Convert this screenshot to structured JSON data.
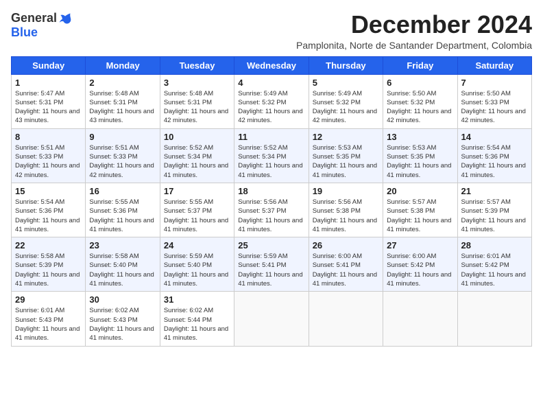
{
  "logo": {
    "general": "General",
    "blue": "Blue"
  },
  "title": "December 2024",
  "location": "Pamplonita, Norte de Santander Department, Colombia",
  "days_of_week": [
    "Sunday",
    "Monday",
    "Tuesday",
    "Wednesday",
    "Thursday",
    "Friday",
    "Saturday"
  ],
  "weeks": [
    [
      {
        "day": "1",
        "sunrise": "5:47 AM",
        "sunset": "5:31 PM",
        "daylight": "11 hours and 43 minutes."
      },
      {
        "day": "2",
        "sunrise": "5:48 AM",
        "sunset": "5:31 PM",
        "daylight": "11 hours and 43 minutes."
      },
      {
        "day": "3",
        "sunrise": "5:48 AM",
        "sunset": "5:31 PM",
        "daylight": "11 hours and 42 minutes."
      },
      {
        "day": "4",
        "sunrise": "5:49 AM",
        "sunset": "5:32 PM",
        "daylight": "11 hours and 42 minutes."
      },
      {
        "day": "5",
        "sunrise": "5:49 AM",
        "sunset": "5:32 PM",
        "daylight": "11 hours and 42 minutes."
      },
      {
        "day": "6",
        "sunrise": "5:50 AM",
        "sunset": "5:32 PM",
        "daylight": "11 hours and 42 minutes."
      },
      {
        "day": "7",
        "sunrise": "5:50 AM",
        "sunset": "5:33 PM",
        "daylight": "11 hours and 42 minutes."
      }
    ],
    [
      {
        "day": "8",
        "sunrise": "5:51 AM",
        "sunset": "5:33 PM",
        "daylight": "11 hours and 42 minutes."
      },
      {
        "day": "9",
        "sunrise": "5:51 AM",
        "sunset": "5:33 PM",
        "daylight": "11 hours and 42 minutes."
      },
      {
        "day": "10",
        "sunrise": "5:52 AM",
        "sunset": "5:34 PM",
        "daylight": "11 hours and 41 minutes."
      },
      {
        "day": "11",
        "sunrise": "5:52 AM",
        "sunset": "5:34 PM",
        "daylight": "11 hours and 41 minutes."
      },
      {
        "day": "12",
        "sunrise": "5:53 AM",
        "sunset": "5:35 PM",
        "daylight": "11 hours and 41 minutes."
      },
      {
        "day": "13",
        "sunrise": "5:53 AM",
        "sunset": "5:35 PM",
        "daylight": "11 hours and 41 minutes."
      },
      {
        "day": "14",
        "sunrise": "5:54 AM",
        "sunset": "5:36 PM",
        "daylight": "11 hours and 41 minutes."
      }
    ],
    [
      {
        "day": "15",
        "sunrise": "5:54 AM",
        "sunset": "5:36 PM",
        "daylight": "11 hours and 41 minutes."
      },
      {
        "day": "16",
        "sunrise": "5:55 AM",
        "sunset": "5:36 PM",
        "daylight": "11 hours and 41 minutes."
      },
      {
        "day": "17",
        "sunrise": "5:55 AM",
        "sunset": "5:37 PM",
        "daylight": "11 hours and 41 minutes."
      },
      {
        "day": "18",
        "sunrise": "5:56 AM",
        "sunset": "5:37 PM",
        "daylight": "11 hours and 41 minutes."
      },
      {
        "day": "19",
        "sunrise": "5:56 AM",
        "sunset": "5:38 PM",
        "daylight": "11 hours and 41 minutes."
      },
      {
        "day": "20",
        "sunrise": "5:57 AM",
        "sunset": "5:38 PM",
        "daylight": "11 hours and 41 minutes."
      },
      {
        "day": "21",
        "sunrise": "5:57 AM",
        "sunset": "5:39 PM",
        "daylight": "11 hours and 41 minutes."
      }
    ],
    [
      {
        "day": "22",
        "sunrise": "5:58 AM",
        "sunset": "5:39 PM",
        "daylight": "11 hours and 41 minutes."
      },
      {
        "day": "23",
        "sunrise": "5:58 AM",
        "sunset": "5:40 PM",
        "daylight": "11 hours and 41 minutes."
      },
      {
        "day": "24",
        "sunrise": "5:59 AM",
        "sunset": "5:40 PM",
        "daylight": "11 hours and 41 minutes."
      },
      {
        "day": "25",
        "sunrise": "5:59 AM",
        "sunset": "5:41 PM",
        "daylight": "11 hours and 41 minutes."
      },
      {
        "day": "26",
        "sunrise": "6:00 AM",
        "sunset": "5:41 PM",
        "daylight": "11 hours and 41 minutes."
      },
      {
        "day": "27",
        "sunrise": "6:00 AM",
        "sunset": "5:42 PM",
        "daylight": "11 hours and 41 minutes."
      },
      {
        "day": "28",
        "sunrise": "6:01 AM",
        "sunset": "5:42 PM",
        "daylight": "11 hours and 41 minutes."
      }
    ],
    [
      {
        "day": "29",
        "sunrise": "6:01 AM",
        "sunset": "5:43 PM",
        "daylight": "11 hours and 41 minutes."
      },
      {
        "day": "30",
        "sunrise": "6:02 AM",
        "sunset": "5:43 PM",
        "daylight": "11 hours and 41 minutes."
      },
      {
        "day": "31",
        "sunrise": "6:02 AM",
        "sunset": "5:44 PM",
        "daylight": "11 hours and 41 minutes."
      },
      null,
      null,
      null,
      null
    ]
  ]
}
